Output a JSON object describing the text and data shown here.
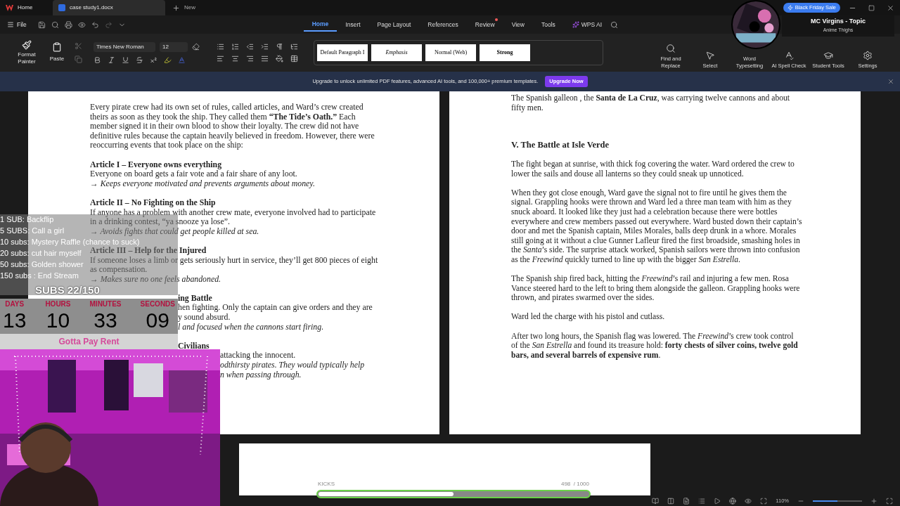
{
  "title_bar": {
    "tabs": [
      {
        "label": "Home",
        "kind": "home",
        "selected": false
      },
      {
        "label": "case study1.docx",
        "kind": "doc",
        "selected": true
      }
    ],
    "new_tab": "New",
    "promo": "Black Friday Sale"
  },
  "menu": {
    "file": "File",
    "tabs": [
      {
        "label": "Home",
        "selected": true,
        "notify": false
      },
      {
        "label": "Insert",
        "selected": false,
        "notify": false
      },
      {
        "label": "Page Layout",
        "selected": false,
        "notify": false
      },
      {
        "label": "References",
        "selected": false,
        "notify": false
      },
      {
        "label": "Review",
        "selected": false,
        "notify": true
      },
      {
        "label": "View",
        "selected": false,
        "notify": false
      },
      {
        "label": "Tools",
        "selected": false,
        "notify": false
      }
    ],
    "ai": "WPS AI"
  },
  "ribbon": {
    "format_painter": "Format Painter",
    "paste": "Paste",
    "font": "Times New Roman",
    "size": "12",
    "styles": [
      {
        "label": "Default Paragraph I",
        "kind": "plain"
      },
      {
        "label": "Emphasis",
        "kind": "italic"
      },
      {
        "label": "Normal (Web)",
        "kind": "plain"
      },
      {
        "label": "Strong",
        "kind": "bold"
      }
    ],
    "tools": [
      {
        "label": "Find and Replace",
        "kind": "search"
      },
      {
        "label": "Select",
        "kind": "select"
      },
      {
        "label": "Word Typesetting",
        "kind": "typeset"
      },
      {
        "label": "AI Spell Check",
        "kind": "spell"
      },
      {
        "label": "Student Tools",
        "kind": "student"
      },
      {
        "label": "Settings",
        "kind": "settings"
      }
    ]
  },
  "banner": {
    "text": "Upgrade to unlock unlimited PDF features, advanced AI tools, and 100,000+ premium templates.",
    "button": "Upgrade Now"
  },
  "left_page": {
    "sections": [
      [
        {
          "kind": "para",
          "text": "Every pirate crew had its own set of rules, called articles, and Ward’s crew created theirs as soon as they took the ship. They called them **“The Tide’s Oath.”** Each member signed it in their own blood to show their loyalty. The crew did not have definitive rules because the captain heavily believed in freedom. However, there were reoccurring events that took place on the ship:"
        }
      ],
      [
        {
          "kind": "heading",
          "text": "Article I – Everyone owns everything"
        },
        {
          "kind": "para",
          "text": "Everyone on board gets a fair vote and a fair share of any loot."
        },
        {
          "kind": "note",
          "text": "→ Keeps everyone motivated and prevents arguments about money."
        }
      ],
      [
        {
          "kind": "heading",
          "text": "Article II – No Fighting on the Ship"
        },
        {
          "kind": "para",
          "text": "If anyone has a problem with another crew mate, everyone involved had to participate in a drinking contest, “ya snooze ya lose”."
        },
        {
          "kind": "note",
          "text": "→ Avoids fights that could get people killed at sea."
        }
      ],
      [
        {
          "kind": "heading",
          "text": "Article III – Help for the Injured"
        },
        {
          "kind": "para",
          "text": "If someone loses a limb or gets seriously hurt in service, they’ll get 800 pieces of eight as compensation."
        },
        {
          "kind": "note",
          "text": "→ Makes sure no one feels abandoned."
        }
      ],
      [
        {
          "kind": "heading",
          "text": "ing Battle",
          "behind_timer": true
        },
        {
          "kind": "para",
          "text": "hen fighting. Only the captain can give orders and they are",
          "behind_timer": true
        },
        {
          "kind": "para",
          "text": "y sound absurd.",
          "behind_timer": true
        },
        {
          "kind": "note",
          "text": "l and focused when the cannons start firing.",
          "behind_timer": true
        }
      ],
      [
        {
          "kind": "heading",
          "text": "Civilians",
          "behind_timer": true
        },
        {
          "kind": "para",
          "text": "attacking the innocent.",
          "behind_camera": true
        },
        {
          "kind": "note",
          "text": "odthirsty pirates. They would typically help",
          "behind_camera": true
        },
        {
          "kind": "note",
          "text": "n when passing through.",
          "behind_camera": true
        }
      ]
    ]
  },
  "right_page": {
    "blocks": [
      {
        "kind": "para",
        "text": "The Spanish galleon , the **Santa de La Cruz**, was carrying twelve cannons and about fifty men."
      },
      {
        "kind": "heading",
        "text": "V. The Battle at Isle Verde"
      },
      {
        "kind": "para",
        "text": "The fight began at sunrise, with thick fog covering the water. Ward ordered the crew to lower the sails and douse all lanterns so they could sneak up unnoticed."
      },
      {
        "kind": "para",
        "text": "When they got close enough, Ward gave the signal not to fire until he gives them the signal. Grappling hooks were thrown and Ward led a three man team with him as they snuck aboard. It looked like they just had a celebration because there were bottles everywhere and crew members passed out everywhere. Ward busted down their captain’s door and met the Spanish captain, Miles Morales, balls deep drunk in a whore. Morales still going at it without a clue Gunner Lafleur fired the first broadside, smashing holes in the *Santa*’s side. The surprise attack worked, Spanish sailors were thrown into confusion as the *Freewind* quickly turned to line up with the bigger *San Estrella*."
      },
      {
        "kind": "para",
        "text": "The Spanish ship fired back, hitting the *Freewind*’s rail and injuring a few men. Rosa Vance steered hard to the left to bring them alongside the galleon. Grappling hooks were thrown, and pirates swarmed over the sides."
      },
      {
        "kind": "para",
        "text": "Ward led the charge with his pistol and cutlass."
      },
      {
        "kind": "para",
        "text": "After two long hours, the Spanish flag was lowered. The *Freewind*’s crew took control of the *San Estrella* and found its treasure hold: **forty chests of silver coins, twelve gold bars, and several barrels of expensive rum**."
      }
    ]
  },
  "status_bar": {
    "zoom": "110%",
    "zoom_slider": {
      "level": 0.5
    }
  },
  "stream": {
    "goals": [
      "1 SUB: Backflip",
      "5 SUBS: Call a girl",
      "10 subs: Mystery Raffle (chance to suck)",
      "20 subs: cut hair myself",
      "50 subs: Golden shower",
      "150 subs : End Stream"
    ],
    "subs_count": "SUBS 22/150",
    "timer": [
      {
        "label": "DAYS",
        "value": "13"
      },
      {
        "label": "HOURS",
        "value": "10"
      },
      {
        "label": "MINUTES",
        "value": "33"
      },
      {
        "label": "SECONDS",
        "value": "09"
      }
    ],
    "timer_caption": "Gotta Pay Rent",
    "now_playing": {
      "title": "MC Virgins - Topic",
      "subtitle": "Anime Thighs"
    },
    "kicks": {
      "label": "KICKS",
      "count": "498  / 1000",
      "level": 0.5
    }
  }
}
